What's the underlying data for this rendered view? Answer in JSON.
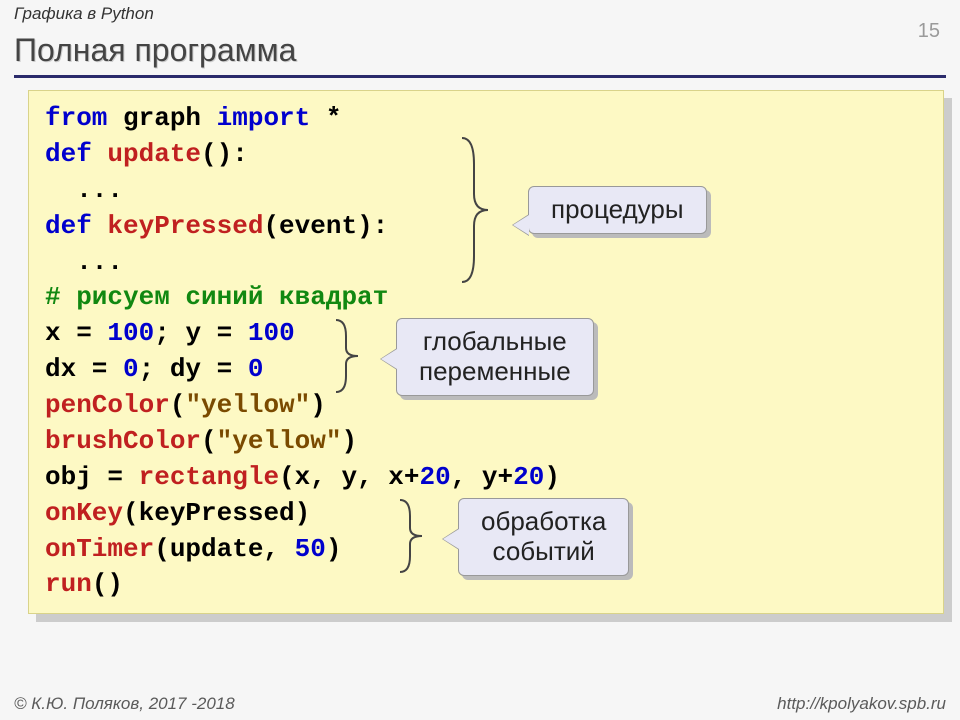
{
  "header": {
    "topic": "Графика в Python",
    "page_number": "15"
  },
  "title": "Полная программа",
  "code": {
    "l1_from": "from ",
    "l1_mod": "graph ",
    "l1_import": "import ",
    "l1_star": "*",
    "l2_def": "def ",
    "l2_name": "update",
    "l2_rest": "():",
    "l3": "  ...",
    "l4_def": "def ",
    "l4_name": "keyPressed",
    "l4_rest": "(event):",
    "l5": "  ...",
    "l6": "# рисуем синий квадрат",
    "l7_a": "x = ",
    "l7_n1": "100",
    "l7_b": "; y = ",
    "l7_n2": "100",
    "l8_a": "dx = ",
    "l8_n1": "0",
    "l8_b": "; dy = ",
    "l8_n2": "0",
    "l9_f": "penColor",
    "l9_p1": "(",
    "l9_s": "\"yellow\"",
    "l9_p2": ")",
    "l10_f": "brushColor",
    "l10_p1": "(",
    "l10_s": "\"yellow\"",
    "l10_p2": ")",
    "l11_a": "obj = ",
    "l11_f": "rectangle",
    "l11_b": "(x, y, x+",
    "l11_n1": "20",
    "l11_c": ", y+",
    "l11_n2": "20",
    "l11_d": ")",
    "l12_f": "onKey",
    "l12_r": "(keyPressed)",
    "l13_f": "onTimer",
    "l13_a": "(update, ",
    "l13_n": "50",
    "l13_b": ")",
    "l14_f": "run",
    "l14_r": "()"
  },
  "callouts": {
    "c1": "процедуры",
    "c2_line1": "глобальные",
    "c2_line2": "переменные",
    "c3_line1": "обработка",
    "c3_line2": "событий"
  },
  "footer": {
    "left": "© К.Ю. Поляков, 2017 -2018",
    "right": "http://kpolyakov.spb.ru"
  }
}
